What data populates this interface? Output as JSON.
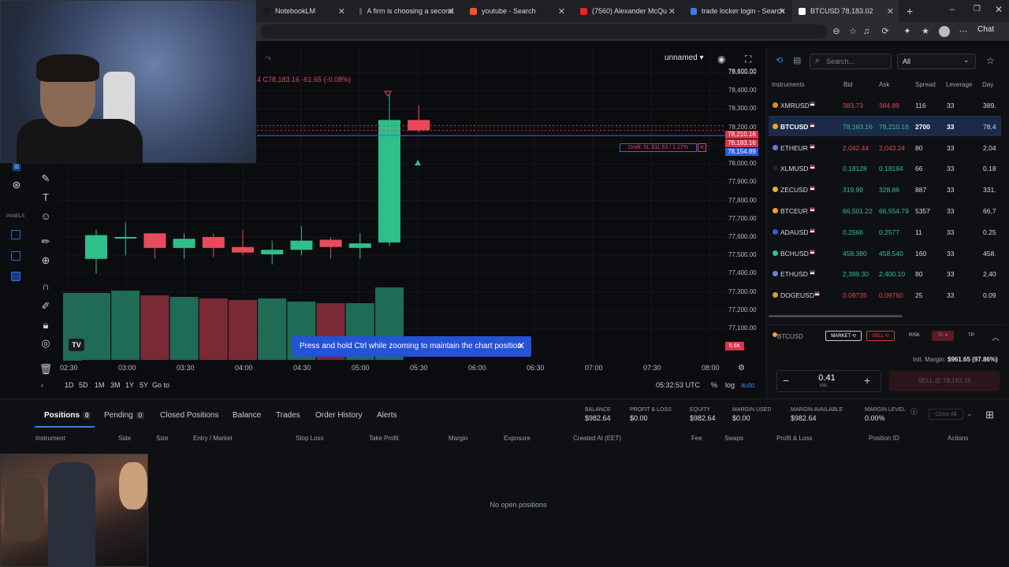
{
  "browser": {
    "tabs": [
      {
        "label": "NotebookLM",
        "x": 326,
        "w": 118
      },
      {
        "label": "A firm is choosing a second",
        "x": 448,
        "w": 135
      },
      {
        "label": "youtube - Search",
        "x": 588,
        "w": 135
      },
      {
        "label": "(7560) Alexander McQu",
        "x": 728,
        "w": 135
      },
      {
        "label": "trade locker login - Search",
        "x": 868,
        "w": 135
      },
      {
        "label": "BTCUSD 78,183.02",
        "x": 1005,
        "w": 135
      }
    ],
    "chat_label": "Chat"
  },
  "chart": {
    "layout_name": "unnamed",
    "ohlc": "4 C78,183.16 -61.65 (-0.08%)",
    "price_axis": [
      "78,500.00",
      "78,400.00",
      "78,300.00",
      "78,200.00",
      "78,100.00",
      "78,000.00",
      "77,900.00",
      "77,800.00",
      "77,700.00",
      "77,600.00",
      "77,500.00",
      "77,400.00",
      "77,300.00",
      "77,200.00",
      "77,100.00"
    ],
    "price_tags": {
      "ask": "78,210.16",
      "bid": "78,183.16",
      "sl": "78,154.89"
    },
    "draft_sl": "Draft: SL $11.53 / 1.17%",
    "time_axis": [
      "02:30",
      "03:00",
      "03:30",
      "04:00",
      "04:30",
      "05:00",
      "05:30",
      "06:00",
      "06:30",
      "07:00",
      "07:30",
      "08:00"
    ],
    "volume_badge": "5.6K",
    "toast": "Press and hold Ctrl while zooming to maintain the chart position",
    "ranges": [
      "1D",
      "5D",
      "1M",
      "3M",
      "1Y",
      "5Y",
      "Go to"
    ],
    "clock": "05:32:53 UTC",
    "pct_label": "%",
    "log_label": "log",
    "auto_label": "auto",
    "panels_label": "PANELS",
    "logo": "TV",
    "colors": {
      "up": "#2fbf8a",
      "down": "#e84a5a",
      "vol_up": "#1f6b55",
      "vol_down": "#7a2a35"
    }
  },
  "chart_data": {
    "type": "candlestick",
    "x": [
      "02:30",
      "02:45",
      "03:00",
      "03:15",
      "03:30",
      "03:45",
      "04:00",
      "04:15",
      "04:30",
      "04:45",
      "05:00",
      "05:15",
      "05:30"
    ],
    "candles": [
      {
        "t": "02:45",
        "o": 77480,
        "h": 77640,
        "l": 77400,
        "c": 77610
      },
      {
        "t": "03:00",
        "o": 77600,
        "h": 77680,
        "l": 77500,
        "c": 77600
      },
      {
        "t": "03:15",
        "o": 77620,
        "h": 77620,
        "l": 77480,
        "c": 77540
      },
      {
        "t": "03:30",
        "o": 77540,
        "h": 77620,
        "l": 77480,
        "c": 77590
      },
      {
        "t": "03:45",
        "o": 77600,
        "h": 77620,
        "l": 77490,
        "c": 77540
      },
      {
        "t": "04:00",
        "o": 77545,
        "h": 77640,
        "l": 77500,
        "c": 77515
      },
      {
        "t": "04:15",
        "o": 77505,
        "h": 77580,
        "l": 77450,
        "c": 77530
      },
      {
        "t": "04:30",
        "o": 77530,
        "h": 77660,
        "l": 77500,
        "c": 77580
      },
      {
        "t": "04:45",
        "o": 77585,
        "h": 77600,
        "l": 77480,
        "c": 77545
      },
      {
        "t": "05:00",
        "o": 77540,
        "h": 77620,
        "l": 77480,
        "c": 77565
      },
      {
        "t": "05:15",
        "o": 77570,
        "h": 78380,
        "l": 77550,
        "c": 78240
      },
      {
        "t": "05:30",
        "o": 78240,
        "h": 78320,
        "l": 78170,
        "c": 78183
      }
    ],
    "ylim": [
      77050,
      78550
    ]
  },
  "instruments": {
    "search_placeholder": "Search...",
    "filter": "All",
    "headers": [
      "Instruments",
      "Bid",
      "Ask",
      "Spread",
      "Leverage",
      "Day"
    ],
    "rows": [
      {
        "sym": "XMRUSD",
        "bid": "383.73",
        "ask": "384.89",
        "spread": "116",
        "lev": "33",
        "day": "389.",
        "dot": "#e08a2a",
        "dir": "down"
      },
      {
        "sym": "BTCUSD",
        "bid": "78,183.16",
        "ask": "78,210.16",
        "spread": "2700",
        "lev": "33",
        "day": "78,4",
        "dot": "#f0a030",
        "dir": "up",
        "selected": true
      },
      {
        "sym": "ETHEUR",
        "bid": "2,042.44",
        "ask": "2,043.24",
        "spread": "80",
        "lev": "33",
        "day": "2,04",
        "dot": "#6a7ce0",
        "dir": "down"
      },
      {
        "sym": "XLMUSD",
        "bid": "0.18128",
        "ask": "0.18194",
        "spread": "66",
        "lev": "33",
        "day": "0.18",
        "dot": "#222",
        "dir": "up"
      },
      {
        "sym": "ZECUSD",
        "bid": "319.99",
        "ask": "328.86",
        "spread": "887",
        "lev": "33",
        "day": "331.",
        "dot": "#e0b030",
        "dir": "up"
      },
      {
        "sym": "BTCEUR",
        "bid": "66,501.22",
        "ask": "66,554.79",
        "spread": "5357",
        "lev": "33",
        "day": "66,7",
        "dot": "#f0a030",
        "dir": "up"
      },
      {
        "sym": "ADAUSD",
        "bid": "0.2566",
        "ask": "0.2577",
        "spread": "11",
        "lev": "33",
        "day": "0.25",
        "dot": "#3a5ad0",
        "dir": "up"
      },
      {
        "sym": "BCHUSD",
        "bid": "458.380",
        "ask": "458.540",
        "spread": "160",
        "lev": "33",
        "day": "458.",
        "dot": "#2fc28b",
        "dir": "up"
      },
      {
        "sym": "ETHUSD",
        "bid": "2,399.30",
        "ask": "2,400.10",
        "spread": "80",
        "lev": "33",
        "day": "2,40",
        "dot": "#6a7ce0",
        "dir": "up"
      },
      {
        "sym": "DOGEUSD",
        "bid": "0.09735",
        "ask": "0.09760",
        "spread": "25",
        "lev": "33",
        "day": "0.09",
        "dot": "#d0a030",
        "dir": "down"
      }
    ]
  },
  "order_ticket": {
    "symbol": "BTCUSD",
    "market": "MARKET",
    "sell_mode": "SELL",
    "risk": "RISK",
    "sl": "SL",
    "tp": "TP",
    "margin_label": "Init. Margin:",
    "margin_value": "$961.65 (97.86%)",
    "qty": "0.41",
    "lots": "lots",
    "sell_button": "SELL @ 78,183.16"
  },
  "bottom": {
    "tabs": [
      {
        "label": "Positions",
        "count": "0"
      },
      {
        "label": "Pending",
        "count": "0"
      },
      {
        "label": "Closed Positions"
      },
      {
        "label": "Balance"
      },
      {
        "label": "Trades"
      },
      {
        "label": "Order History"
      },
      {
        "label": "Alerts"
      }
    ],
    "account": [
      {
        "label": "BALANCE",
        "value": "$982.64"
      },
      {
        "label": "PROFIT & LOSS",
        "value": "$0.00"
      },
      {
        "label": "EQUITY",
        "value": "$982.64"
      },
      {
        "label": "MARGIN USED",
        "value": "$0.00"
      },
      {
        "label": "MARGIN AVAILABLE",
        "value": "$982.64"
      },
      {
        "label": "MARGIN LEVEL",
        "value": "0.00%"
      }
    ],
    "close_all": "Close All",
    "columns": [
      "Instrument",
      "Side",
      "Size",
      "Entry / Market",
      "Stop Loss",
      "Take Profit",
      "Margin",
      "Exposure",
      "Created At (EET)",
      "Fee",
      "Swaps",
      "Profit & Loss",
      "Position ID",
      "Actions"
    ],
    "empty": "No open positions"
  }
}
